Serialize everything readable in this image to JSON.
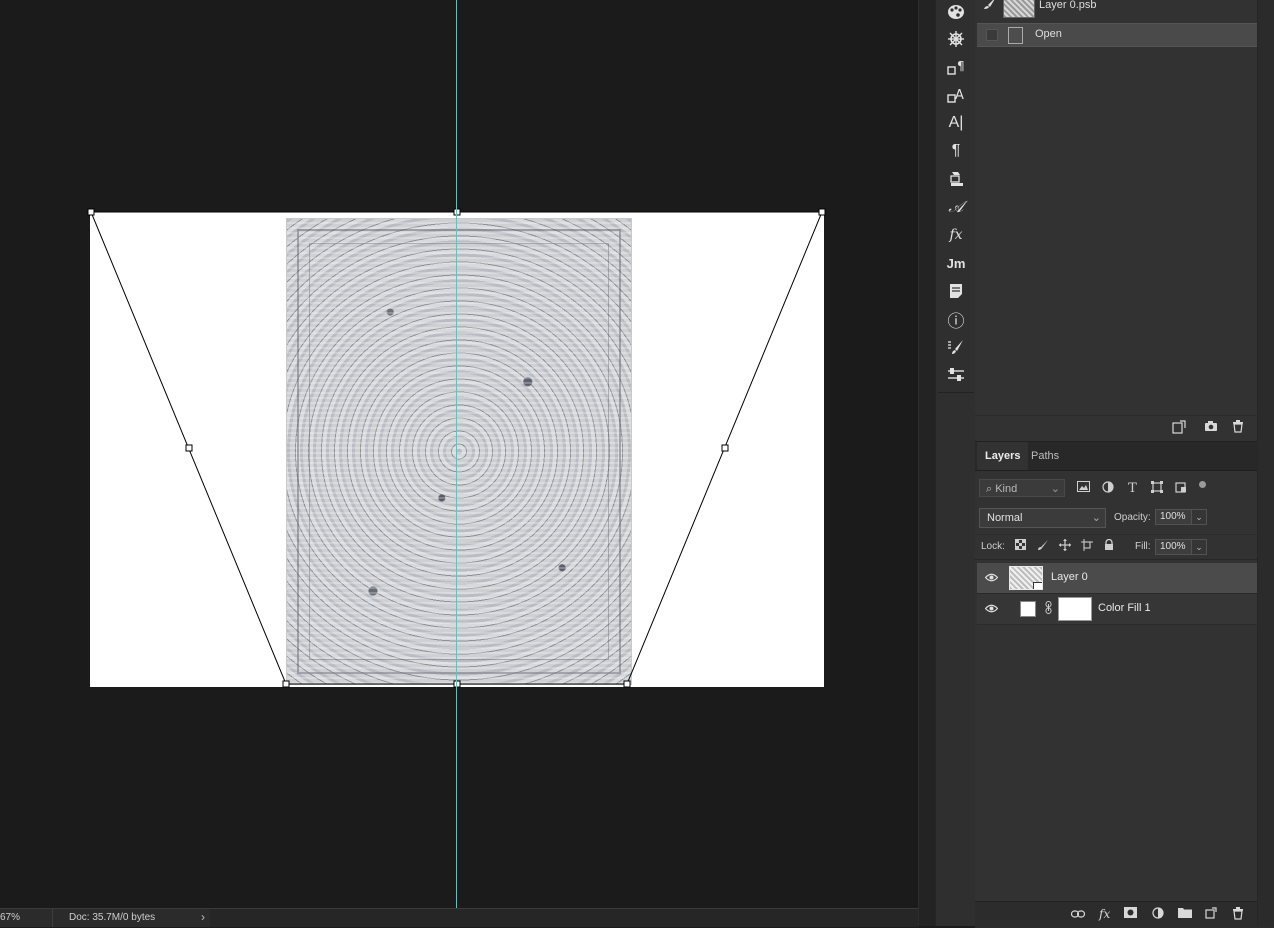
{
  "canvas": {
    "guide_color": "#33d6d0",
    "background_color": "#1b1b1b"
  },
  "status_bar": {
    "zoom": "67%",
    "doc_info": "Doc: 35.7M/0 bytes",
    "arrow": "›"
  },
  "icon_strip": {
    "icons": [
      "color-palette-icon",
      "navigator-wheel-icon",
      "paragraph-styles-icon",
      "character-styles-icon",
      "character-icon",
      "paragraph-icon",
      "3d-icon",
      "glyphs-icon",
      "styles-fx-icon",
      "jm-plugin-icon",
      "notes-icon",
      "info-icon",
      "brush-presets-icon",
      "properties-adjust-icon"
    ],
    "jm_label": "Jm",
    "fx_label": "fx",
    "char_label": "A|",
    "glyph_label": "𝒜",
    "para_label": "¶",
    "info_label": "ⓘ"
  },
  "history": {
    "snapshot_label": "Layer 0.psb",
    "open_label": "Open"
  },
  "layers_panel": {
    "tabs": [
      "Layers",
      "Paths"
    ],
    "kind_placeholder": "⌕ Kind",
    "blend_mode": "Normal",
    "opacity_label": "Opacity:",
    "opacity_value": "100%",
    "lock_label": "Lock:",
    "fill_label": "Fill:",
    "fill_value": "100%",
    "layers": [
      {
        "name": "Layer 0",
        "selected": true
      },
      {
        "name": "Color Fill 1",
        "selected": false
      }
    ]
  },
  "colors": {
    "panel_bg": "#323232",
    "selected_row": "#4b4b4b",
    "accent_guide": "#33d6d0"
  }
}
